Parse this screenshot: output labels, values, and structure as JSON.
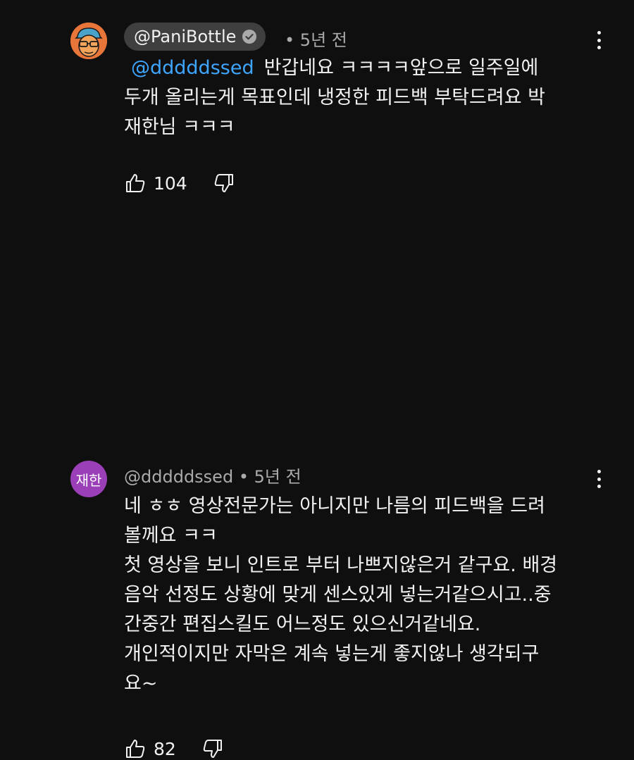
{
  "comments": [
    {
      "author": "@PaniBottle",
      "verified": true,
      "separator": "•",
      "time": "5년 전",
      "mention": "@dddddssed",
      "lines": [
        "반갑네요 ㅋㅋㅋㅋ앞으로 일주일에",
        "두개 올리는게 목표인데 냉정한 피드백 부탁드려요 박",
        "재한님 ㅋㅋㅋ"
      ],
      "likes": "104",
      "avatar_icon": "cartoon-face-avatar"
    },
    {
      "author": "@dddddssed",
      "separator": "•",
      "time": "5년 전",
      "avatar_text": "재한",
      "lines": [
        "네 ㅎㅎ 영상전문가는 아니지만 나름의 피드백을 드려",
        "볼께요 ㅋㅋ",
        "첫 영상을 보니 인트로 부터 나쁘지않은거 같구요. 배경",
        "음악 선정도 상황에 맞게 센스있게 넣는거같으시고..중",
        "간중간 편집스킬도 어느정도 있으신거같네요.",
        "개인적이지만 자막은 계속 넣는게 좋지않나 생각되구",
        "요~"
      ],
      "likes": "82"
    }
  ],
  "colors": {
    "background": "#0f0f0f",
    "text": "#f1f1f1",
    "meta": "#aaaaaa",
    "mention": "#3ea6ff",
    "chip": "#3f3f3f",
    "avatar2": "#9b3fb8"
  }
}
